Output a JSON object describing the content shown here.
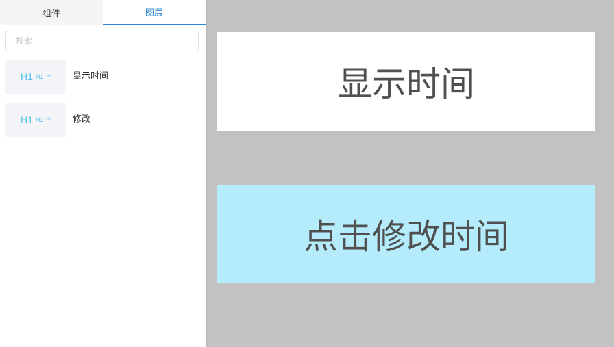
{
  "sidebar": {
    "tabs": [
      {
        "label": "组件",
        "active": false
      },
      {
        "label": "图层",
        "active": true
      }
    ],
    "search": {
      "placeholder": "搜索",
      "value": ""
    },
    "layers": [
      {
        "thumb": {
          "large": "H1",
          "medium": "H1",
          "small": "H1"
        },
        "label": "显示时间"
      },
      {
        "thumb": {
          "large": "H1",
          "medium": "H1",
          "small": "H1"
        },
        "label": "修改"
      }
    ]
  },
  "canvas": {
    "time_text": "显示时间",
    "button_text": "点击修改时间"
  },
  "colors": {
    "accent": "#2f88d6",
    "canvas_bg": "#c2c2c2",
    "button_bg": "#b4ecfb",
    "thumb_text": "#4fc0e6"
  }
}
